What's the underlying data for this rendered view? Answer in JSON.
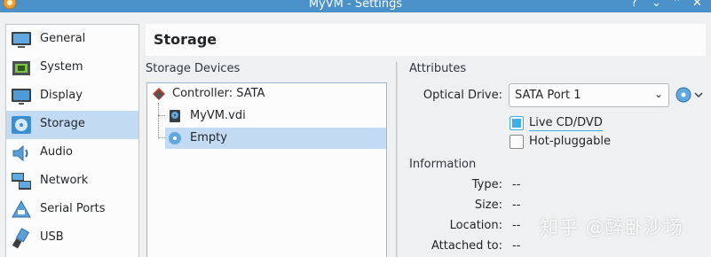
{
  "window": {
    "title": "MyVM - Settings",
    "help_glyph": "?",
    "minimize_glyph": "⌄",
    "maximize_glyph": "⌃",
    "close_glyph": "✕"
  },
  "sidebar": {
    "items": [
      {
        "label": "General",
        "icon": "monitor-icon"
      },
      {
        "label": "System",
        "icon": "chip-icon"
      },
      {
        "label": "Display",
        "icon": "display-icon"
      },
      {
        "label": "Storage",
        "icon": "disc-icon",
        "selected": true
      },
      {
        "label": "Audio",
        "icon": "speaker-icon"
      },
      {
        "label": "Network",
        "icon": "network-icon"
      },
      {
        "label": "Serial Ports",
        "icon": "serial-port-icon"
      },
      {
        "label": "USB",
        "icon": "usb-icon"
      }
    ]
  },
  "page": {
    "title": "Storage"
  },
  "storage_devices": {
    "title": "Storage Devices",
    "controller": "Controller: SATA",
    "attachments": [
      {
        "label": "MyVM.vdi",
        "icon": "hard-disk-icon"
      },
      {
        "label": "Empty",
        "icon": "optical-disc-icon",
        "selected": true
      }
    ]
  },
  "attributes": {
    "title": "Attributes",
    "optical_drive_label": "Optical Drive:",
    "optical_drive_value": "SATA Port 1",
    "live_cd_label": "Live CD/DVD",
    "live_cd_checked": true,
    "hot_pluggable_label": "Hot-pluggable",
    "hot_pluggable_checked": false
  },
  "information": {
    "title": "Information",
    "rows": [
      {
        "label": "Type:",
        "value": "--"
      },
      {
        "label": "Size:",
        "value": "--"
      },
      {
        "label": "Location:",
        "value": "--"
      },
      {
        "label": "Attached to:",
        "value": "--"
      }
    ]
  },
  "watermark": "知乎 @醉卧沙场",
  "colors": {
    "accent": "#3daee9",
    "selection": "#c2dbf2",
    "titlebar": "#4a90c9"
  }
}
